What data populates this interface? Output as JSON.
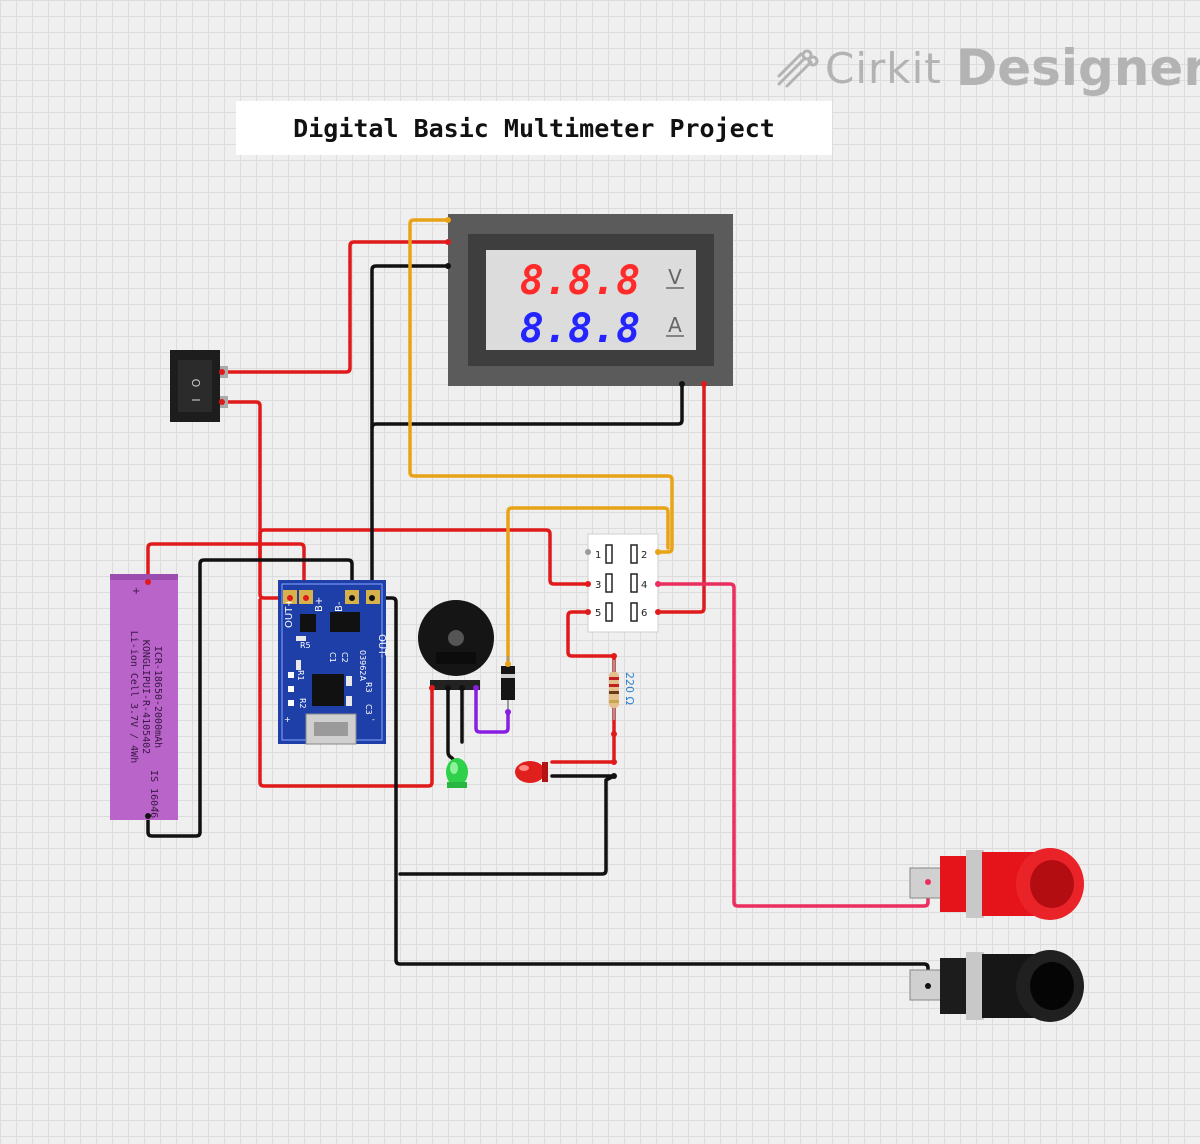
{
  "app": {
    "logo_cirkit": "Cirkit",
    "logo_designer": "Designer"
  },
  "title": "Digital Basic Multimeter Project",
  "meter": {
    "volt_reading": "8.8.8",
    "amp_reading": "8.8.8",
    "volt_unit": "V",
    "amp_unit": "A",
    "volt_color": "#ff2b2b",
    "amp_color": "#2424ff"
  },
  "switch": {
    "on_mark": "O",
    "off_mark": "I"
  },
  "battery": {
    "lines": [
      "ICR-18650-2000mAh",
      "KONGLIPUI-R-4105402",
      "Li-ion Cell 3.7V / 4Wh"
    ],
    "code": "IS 16046",
    "plus": "+",
    "minus": "-"
  },
  "charger": {
    "pins_top": [
      "OUT+",
      "B+",
      "B-",
      "OUT-"
    ],
    "labels": [
      "R5",
      "C1",
      "C2",
      "03962A",
      "R1",
      "R2",
      "R3",
      "C3",
      "+",
      "-"
    ]
  },
  "selector": {
    "pins": [
      "1",
      "2",
      "3",
      "4",
      "5",
      "6"
    ]
  },
  "resistor": {
    "label": "220 Ω"
  },
  "colors": {
    "wire_red": "#e01a1a",
    "wire_black": "#111111",
    "wire_orange": "#e8a317",
    "wire_purple": "#8a1ee0",
    "wire_pink": "#ec2d5f",
    "battery": "#b864c9",
    "charger_pcb": "#1f3fa8",
    "jack_red": "#e5141b",
    "jack_black": "#161616"
  }
}
